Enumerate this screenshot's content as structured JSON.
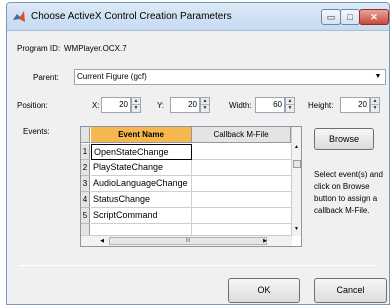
{
  "window": {
    "title": "Choose ActiveX Control Creation Parameters",
    "minimize_glyph": "▭",
    "maximize_glyph": "□",
    "close_glyph": "✕"
  },
  "program": {
    "label": "Program ID:",
    "value": "WMPlayer.OCX.7"
  },
  "parent": {
    "label": "Parent:",
    "value": "Current Figure (gcf)"
  },
  "position": {
    "label": "Position:",
    "x_label": "X:",
    "x_value": "20",
    "y_label": "Y:",
    "y_value": "20",
    "width_label": "Width:",
    "width_value": "60",
    "height_label": "Height:",
    "height_value": "20"
  },
  "events": {
    "label": "Events:",
    "columns": [
      "Event Name",
      "Callback M-File"
    ],
    "rows": [
      {
        "num": "1",
        "name": "OpenStateChange",
        "callback": ""
      },
      {
        "num": "2",
        "name": "PlayStateChange",
        "callback": ""
      },
      {
        "num": "3",
        "name": "AudioLanguageChange",
        "callback": ""
      },
      {
        "num": "4",
        "name": "StatusChange",
        "callback": ""
      },
      {
        "num": "5",
        "name": "ScriptCommand",
        "callback": ""
      }
    ],
    "hscroll_grip": "III"
  },
  "browse_label": "Browse",
  "help_text": "Select event(s) and click on Browse button to assign a callback M-File.",
  "ok_label": "OK",
  "cancel_label": "Cancel",
  "colors": {
    "selected_header": "#f5b74e",
    "titlebar": "#c6daf0",
    "close_button": "#c8483a"
  }
}
